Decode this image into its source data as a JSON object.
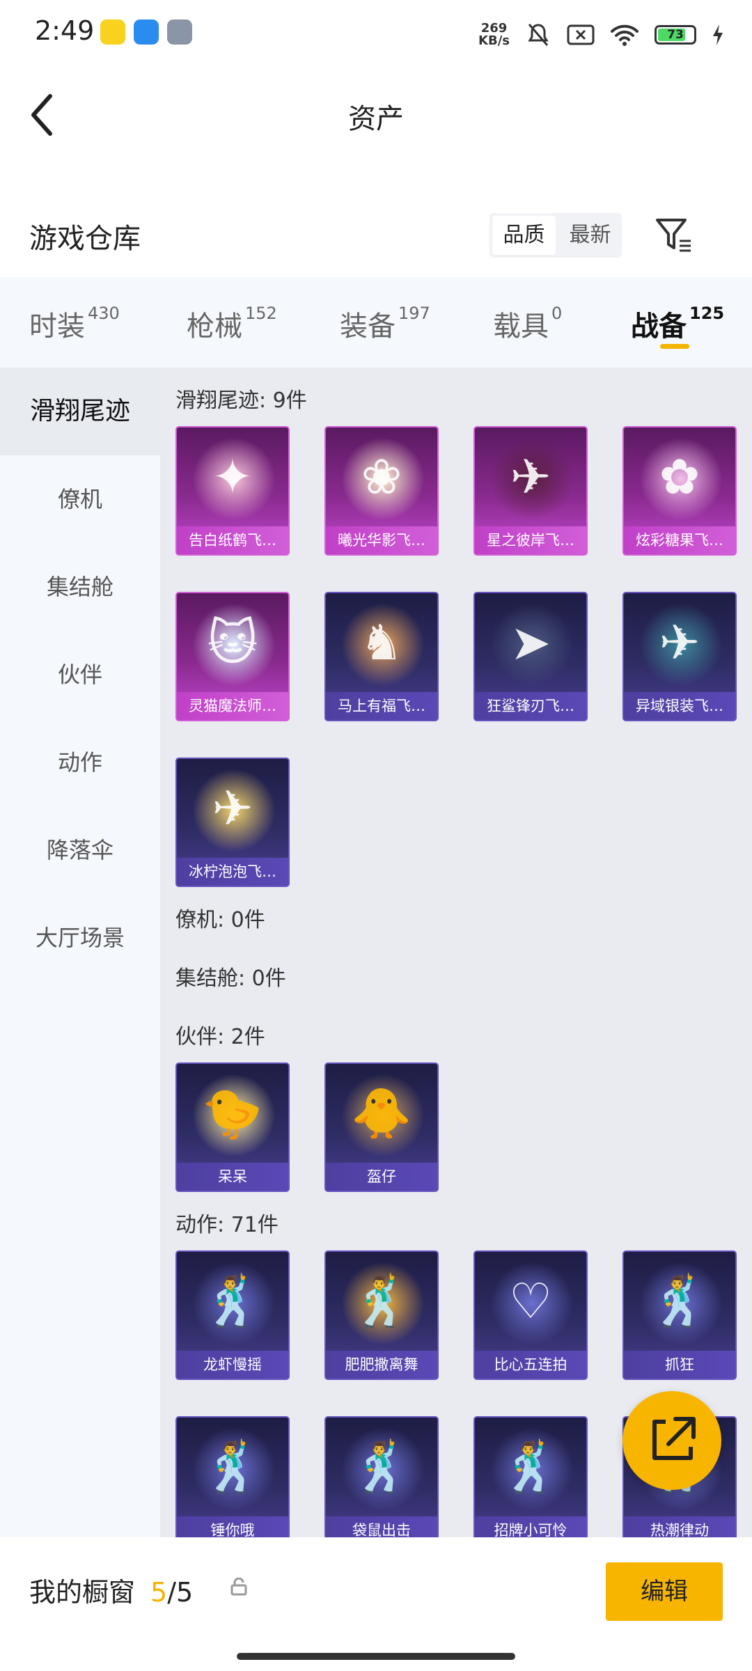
{
  "status": {
    "time": "2:49",
    "net_speed_value": "269",
    "net_speed_unit": "KB/s",
    "battery": "73"
  },
  "header": {
    "title": "资产"
  },
  "section": {
    "title": "游戏仓库"
  },
  "sort": {
    "quality": "品质",
    "newest": "最新",
    "active": "quality"
  },
  "tabs": [
    {
      "label": "时装",
      "count": "430"
    },
    {
      "label": "枪械",
      "count": "152"
    },
    {
      "label": "装备",
      "count": "197"
    },
    {
      "label": "载具",
      "count": "0"
    },
    {
      "label": "战备",
      "count": "125",
      "active": true
    }
  ],
  "sidebar": [
    "滑翔尾迹",
    "僚机",
    "集结舱",
    "伙伴",
    "动作",
    "降落伞",
    "大厅场景"
  ],
  "groups": {
    "glide": {
      "title": "滑翔尾迹: 9件",
      "items": [
        "告白纸鹤飞…",
        "曦光华影飞…",
        "星之彼岸飞…",
        "炫彩糖果飞…",
        "灵猫魔法师…",
        "马上有福飞…",
        "狂鲨锋刃飞…",
        "异域银装飞…",
        "冰柠泡泡飞…"
      ]
    },
    "wingman": {
      "title": "僚机: 0件"
    },
    "pod": {
      "title": "集结舱: 0件"
    },
    "partner": {
      "title": "伙伴: 2件",
      "items": [
        "呆呆",
        "盔仔"
      ]
    },
    "emote": {
      "title": "动作: 71件",
      "items": [
        "龙虾慢摇",
        "肥肥撒离舞",
        "比心五连拍",
        "抓狂",
        "锤你哦",
        "袋鼠出击",
        "招牌小可怜",
        "热潮律动"
      ]
    }
  },
  "bottom": {
    "label": "我的橱窗",
    "current": "5",
    "total": "/5",
    "edit": "编辑"
  },
  "colors": {
    "accent": "#f7b500",
    "pink_card": "#c24ad0",
    "blue_card": "#4a3f92"
  }
}
